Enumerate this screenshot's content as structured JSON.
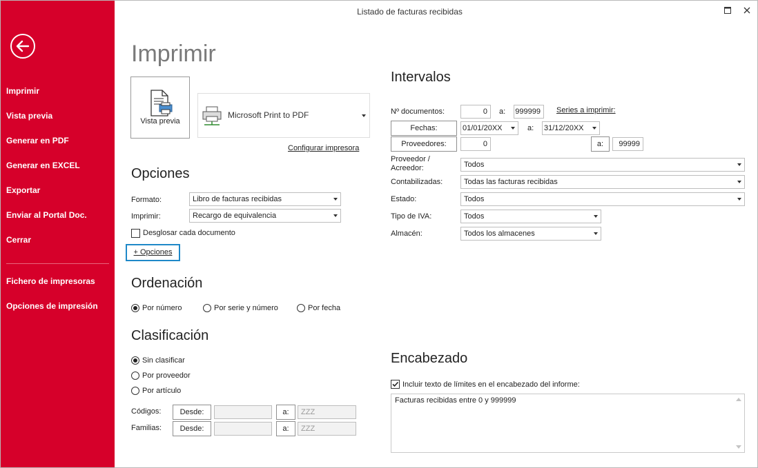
{
  "window": {
    "title": "Listado de facturas recibidas"
  },
  "sidebar": {
    "items": [
      {
        "label": "Imprimir"
      },
      {
        "label": "Vista previa"
      },
      {
        "label": "Generar en PDF"
      },
      {
        "label": "Generar en EXCEL"
      },
      {
        "label": "Exportar"
      },
      {
        "label": "Enviar al Portal Doc."
      },
      {
        "label": "Cerrar"
      }
    ],
    "bottom_items": [
      {
        "label": "Fichero de impresoras"
      },
      {
        "label": "Opciones de impresión"
      }
    ]
  },
  "main": {
    "title": "Imprimir",
    "preview_label": "Vista previa",
    "printer_name": "Microsoft Print to PDF",
    "configure_link": "Configurar impresora"
  },
  "opciones": {
    "heading": "Opciones",
    "formato_label": "Formato:",
    "formato_value": "Libro de facturas recibidas",
    "imprimir_label": "Imprimir:",
    "imprimir_value": "Recargo de equivalencia",
    "desglosar_label": "Desglosar cada documento",
    "mas_opciones": "+ Opciones"
  },
  "ordenacion": {
    "heading": "Ordenación",
    "options": [
      {
        "label": "Por número",
        "selected": true
      },
      {
        "label": "Por serie y número",
        "selected": false
      },
      {
        "label": "Por fecha",
        "selected": false
      }
    ]
  },
  "clasificacion": {
    "heading": "Clasificación",
    "options": [
      {
        "label": "Sin clasificar",
        "selected": true
      },
      {
        "label": "Por proveedor",
        "selected": false
      },
      {
        "label": "Por artículo",
        "selected": false
      }
    ],
    "codigos_label": "Códigos:",
    "familias_label": "Familias:",
    "desde_label": "Desde:",
    "a_label": "a:",
    "hasta_value": "ZZZ"
  },
  "intervalos": {
    "heading": "Intervalos",
    "documentos_label": "Nº documentos:",
    "documentos_from": "0",
    "documentos_to": "999999",
    "a_label": "a:",
    "series_link": "Series a imprimir:",
    "fechas_btn": "Fechas:",
    "fecha_from": "01/01/20XX",
    "fecha_to": "31/12/20XX",
    "proveedores_btn": "Proveedores:",
    "proveedores_from": "0",
    "proveedores_to": "99999",
    "proveedor_label": "Proveedor /\nAcreedor:",
    "proveedor_value": "Todos",
    "contabilizadas_label": "Contabilizadas:",
    "contabilizadas_value": "Todas las facturas recibidas",
    "estado_label": "Estado:",
    "estado_value": "Todos",
    "tipo_iva_label": "Tipo de IVA:",
    "tipo_iva_value": "Todos",
    "almacen_label": "Almacén:",
    "almacen_value": "Todos los almacenes"
  },
  "encabezado": {
    "heading": "Encabezado",
    "incluir_label": "Incluir texto de límites en el encabezado del informe:",
    "incluir_checked": true,
    "text": "Facturas recibidas entre 0 y 999999"
  },
  "colors": {
    "sidebar_bg": "#d6002a",
    "focus_border": "#1e88c8"
  }
}
